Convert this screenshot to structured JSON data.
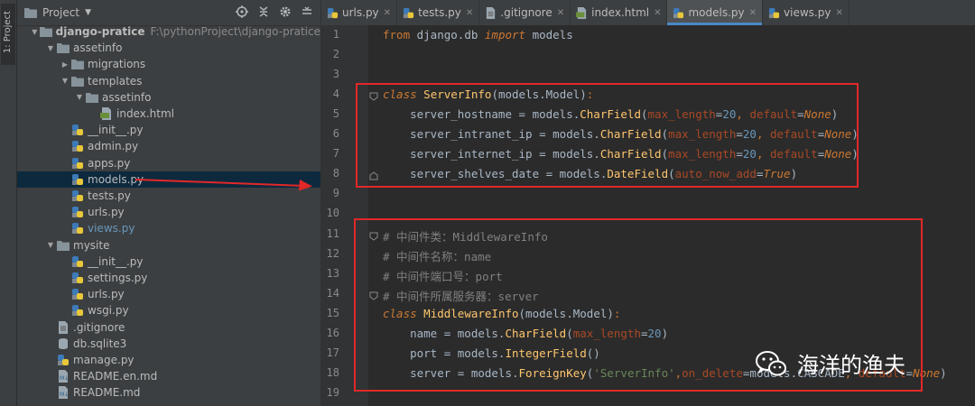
{
  "side_tab": {
    "label": "1: Project"
  },
  "panel": {
    "title": "Project"
  },
  "tree": [
    {
      "name": "django-pratice",
      "path": "F:\\pythonProject\\django-pratice",
      "type": "folder",
      "depth": 0,
      "expanded": true,
      "bold": true
    },
    {
      "name": "assetinfo",
      "type": "folder",
      "depth": 1,
      "expanded": true
    },
    {
      "name": "migrations",
      "type": "folder",
      "depth": 2,
      "expanded": false
    },
    {
      "name": "templates",
      "type": "folder",
      "depth": 2,
      "expanded": true
    },
    {
      "name": "assetinfo",
      "type": "folder",
      "depth": 3,
      "expanded": true
    },
    {
      "name": "index.html",
      "type": "html",
      "depth": 4
    },
    {
      "name": "__init__.py",
      "type": "py",
      "depth": 2
    },
    {
      "name": "admin.py",
      "type": "py",
      "depth": 2
    },
    {
      "name": "apps.py",
      "type": "py",
      "depth": 2
    },
    {
      "name": "models.py",
      "type": "py",
      "depth": 2,
      "selected": true
    },
    {
      "name": "tests.py",
      "type": "py",
      "depth": 2
    },
    {
      "name": "urls.py",
      "type": "py",
      "depth": 2
    },
    {
      "name": "views.py",
      "type": "py",
      "depth": 2,
      "highlight": true
    },
    {
      "name": "mysite",
      "type": "folder",
      "depth": 1,
      "expanded": true
    },
    {
      "name": "__init__.py",
      "type": "py",
      "depth": 2
    },
    {
      "name": "settings.py",
      "type": "py",
      "depth": 2
    },
    {
      "name": "urls.py",
      "type": "py",
      "depth": 2
    },
    {
      "name": "wsgi.py",
      "type": "py",
      "depth": 2
    },
    {
      "name": ".gitignore",
      "type": "text",
      "depth": 1
    },
    {
      "name": "db.sqlite3",
      "type": "db",
      "depth": 1
    },
    {
      "name": "manage.py",
      "type": "py",
      "depth": 1
    },
    {
      "name": "README.en.md",
      "type": "md",
      "depth": 1
    },
    {
      "name": "README.md",
      "type": "md",
      "depth": 1
    }
  ],
  "tabs": [
    {
      "name": "urls.py",
      "type": "py",
      "active": false
    },
    {
      "name": "tests.py",
      "type": "py",
      "active": false
    },
    {
      "name": ".gitignore",
      "type": "text",
      "active": false
    },
    {
      "name": "index.html",
      "type": "html",
      "active": false
    },
    {
      "name": "models.py",
      "type": "py",
      "active": true
    },
    {
      "name": "views.py",
      "type": "py",
      "active": false
    }
  ],
  "code_lines": [
    [
      [
        "k",
        "from"
      ],
      [
        "t",
        " django.db "
      ],
      [
        "ki",
        "import"
      ],
      [
        "t",
        " models"
      ]
    ],
    [],
    [],
    [
      [
        "ki",
        "class"
      ],
      [
        "t",
        " "
      ],
      [
        "cls",
        "ServerInfo"
      ],
      [
        "t",
        "(models.Model)"
      ],
      [
        "k",
        ":"
      ]
    ],
    [
      [
        "t",
        "    server_hostname = models."
      ],
      [
        "cls",
        "CharField"
      ],
      [
        "t",
        "("
      ],
      [
        "pname",
        "max_length"
      ],
      [
        "t",
        "="
      ],
      [
        "n",
        "20"
      ],
      [
        "k",
        ","
      ],
      [
        "t",
        " "
      ],
      [
        "pname",
        "default"
      ],
      [
        "t",
        "="
      ],
      [
        "ki",
        "None"
      ],
      [
        "t",
        ")"
      ]
    ],
    [
      [
        "t",
        "    server_intranet_ip = models."
      ],
      [
        "cls",
        "CharField"
      ],
      [
        "t",
        "("
      ],
      [
        "pname",
        "max_length"
      ],
      [
        "t",
        "="
      ],
      [
        "n",
        "20"
      ],
      [
        "k",
        ","
      ],
      [
        "t",
        " "
      ],
      [
        "pname",
        "default"
      ],
      [
        "t",
        "="
      ],
      [
        "ki",
        "None"
      ],
      [
        "t",
        ")"
      ]
    ],
    [
      [
        "t",
        "    server_internet_ip = models."
      ],
      [
        "cls",
        "CharField"
      ],
      [
        "t",
        "("
      ],
      [
        "pname",
        "max_length"
      ],
      [
        "t",
        "="
      ],
      [
        "n",
        "20"
      ],
      [
        "k",
        ","
      ],
      [
        "t",
        " "
      ],
      [
        "pname",
        "default"
      ],
      [
        "t",
        "="
      ],
      [
        "ki",
        "None"
      ],
      [
        "t",
        ")"
      ]
    ],
    [
      [
        "t",
        "    server_shelves_date = models."
      ],
      [
        "cls",
        "DateField"
      ],
      [
        "t",
        "("
      ],
      [
        "pname",
        "auto_now_add"
      ],
      [
        "t",
        "="
      ],
      [
        "ki",
        "True"
      ],
      [
        "t",
        ")"
      ]
    ],
    [],
    [],
    [
      [
        "cmt",
        "# 中间件类：MiddlewareInfo"
      ]
    ],
    [
      [
        "cmt",
        "# 中间件名称：name"
      ]
    ],
    [
      [
        "cmt",
        "# 中间件端口号：port"
      ]
    ],
    [
      [
        "cmt",
        "# 中间件所属服务器：server"
      ]
    ],
    [
      [
        "ki",
        "class"
      ],
      [
        "t",
        " "
      ],
      [
        "cls",
        "MiddlewareInfo"
      ],
      [
        "t",
        "(models.Model)"
      ],
      [
        "k",
        ":"
      ]
    ],
    [
      [
        "t",
        "    name = models."
      ],
      [
        "cls",
        "CharField"
      ],
      [
        "t",
        "("
      ],
      [
        "pname",
        "max_length"
      ],
      [
        "t",
        "="
      ],
      [
        "n",
        "20"
      ],
      [
        "t",
        ")"
      ]
    ],
    [
      [
        "t",
        "    port = models."
      ],
      [
        "cls",
        "IntegerField"
      ],
      [
        "t",
        "()"
      ]
    ],
    [
      [
        "t",
        "    server = models."
      ],
      [
        "cls",
        "ForeignKey"
      ],
      [
        "t",
        "("
      ],
      [
        "str",
        "'ServerInfo'"
      ],
      [
        "k",
        ","
      ],
      [
        "pname",
        "on_delete"
      ],
      [
        "t",
        "=models.CASCADE"
      ],
      [
        "k",
        ","
      ],
      [
        "t",
        " "
      ],
      [
        "pname",
        "default"
      ],
      [
        "t",
        "="
      ],
      [
        "ki",
        "None"
      ],
      [
        "t",
        ")"
      ]
    ],
    []
  ],
  "watermark": {
    "text": "海洋的渔夫"
  }
}
